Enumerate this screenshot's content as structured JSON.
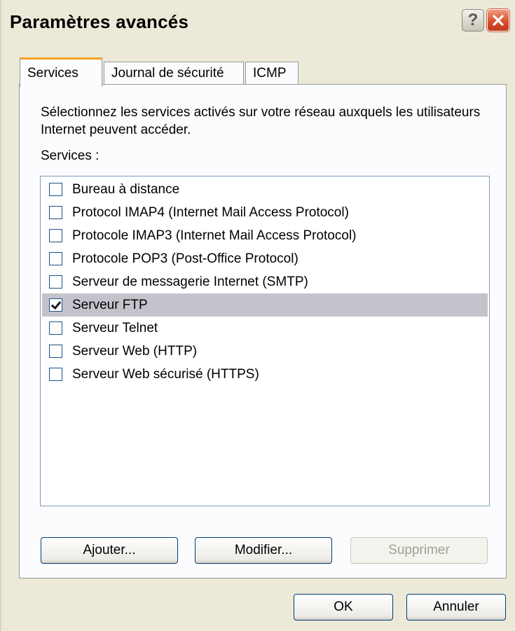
{
  "window": {
    "title": "Paramètres avancés",
    "help_label": "?"
  },
  "tabs": [
    {
      "label": "Services",
      "active": true
    },
    {
      "label": "Journal de sécurité",
      "active": false
    },
    {
      "label": "ICMP",
      "active": false
    }
  ],
  "panel": {
    "description": "Sélectionnez les services activés sur votre réseau auxquels les utilisateurs Internet peuvent accéder.",
    "services_label": "Services :",
    "services": [
      {
        "label": "Bureau à distance",
        "checked": false
      },
      {
        "label": "Protocol IMAP4 (Internet Mail Access Protocol)",
        "checked": false
      },
      {
        "label": "Protocole IMAP3 (Internet Mail Access Protocol)",
        "checked": false
      },
      {
        "label": "Protocole POP3 (Post-Office Protocol)",
        "checked": false
      },
      {
        "label": "Serveur de messagerie Internet (SMTP)",
        "checked": false
      },
      {
        "label": "Serveur FTP",
        "checked": true,
        "selected": true
      },
      {
        "label": "Serveur Telnet",
        "checked": false
      },
      {
        "label": "Serveur Web (HTTP)",
        "checked": false
      },
      {
        "label": "Serveur Web sécurisé (HTTPS)",
        "checked": false
      }
    ],
    "buttons": {
      "add": "Ajouter...",
      "edit": "Modifier...",
      "delete": "Supprimer"
    }
  },
  "footer": {
    "ok": "OK",
    "cancel": "Annuler"
  },
  "colors": {
    "dialog_bg": "#ece9d8",
    "active_tab_accent": "#f5a123",
    "selection_bg": "#c4c3cb",
    "close_button": "#d64a2a"
  }
}
